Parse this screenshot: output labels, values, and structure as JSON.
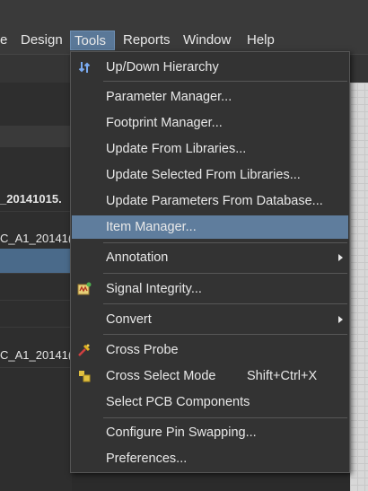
{
  "menubar": {
    "items": [
      {
        "label": "e"
      },
      {
        "label": "Design"
      },
      {
        "label": "Tools"
      },
      {
        "label": "Reports"
      },
      {
        "label": "Window"
      },
      {
        "label": "Help"
      }
    ]
  },
  "left_panel": {
    "rows": [
      "_20141015.",
      "C_A1_20141(",
      "",
      "",
      "",
      "C_A1_20141("
    ]
  },
  "tools_menu": {
    "items": [
      {
        "label": "Up/Down Hierarchy",
        "icon": "hierarchy-arrows-icon"
      },
      {
        "label": "Parameter Manager..."
      },
      {
        "label": "Footprint Manager..."
      },
      {
        "label": "Update From Libraries..."
      },
      {
        "label": "Update Selected From Libraries..."
      },
      {
        "label": "Update Parameters From Database..."
      },
      {
        "label": "Item Manager..."
      },
      {
        "label": "Annotation"
      },
      {
        "label": "Signal Integrity...",
        "icon": "signal-integrity-icon"
      },
      {
        "label": "Convert"
      },
      {
        "label": "Cross Probe",
        "icon": "cross-probe-icon"
      },
      {
        "label": "Cross Select Mode",
        "icon": "cross-select-icon",
        "shortcut": "Shift+Ctrl+X"
      },
      {
        "label": "Select PCB Components"
      },
      {
        "label": "Configure Pin Swapping..."
      },
      {
        "label": "Preferences..."
      }
    ]
  },
  "colors": {
    "highlight": "#5f7d9d",
    "menu_bg": "#333333",
    "text": "#e8e8e8"
  }
}
